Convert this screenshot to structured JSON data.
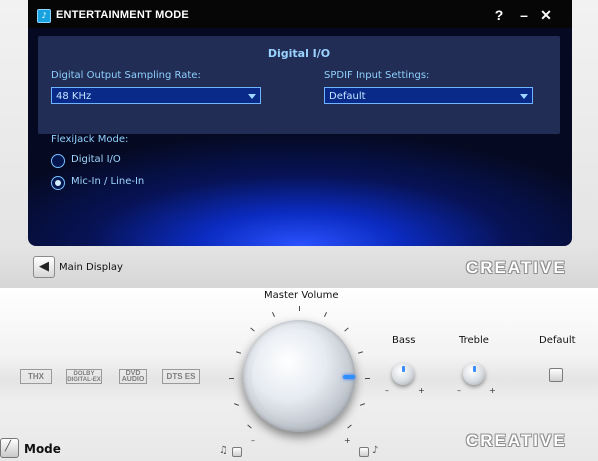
{
  "window": {
    "title": "ENTERTAINMENT MODE",
    "help_label": "?",
    "minimize_label": "–",
    "close_label": "✕",
    "icon": "speaker-app-icon"
  },
  "panel": {
    "title": "Digital I/O",
    "output_rate": {
      "label": "Digital Output Sampling Rate:",
      "value": "48 KHz"
    },
    "spdif": {
      "label": "SPDIF Input Settings:",
      "value": "Default"
    }
  },
  "flexijack": {
    "label": "FlexiJack Mode:",
    "options": [
      {
        "label": "Digital I/O",
        "selected": false
      },
      {
        "label": "Mic-In / Line-In",
        "selected": true
      }
    ]
  },
  "nav": {
    "back_label": "Main Display",
    "back_icon": "arrow-left-icon"
  },
  "brand": "CREATIVE",
  "controls": {
    "master_volume_label": "Master Volume",
    "bass_label": "Bass",
    "treble_label": "Treble",
    "default_label": "Default",
    "plus": "+",
    "minus": "–"
  },
  "logos": [
    "THX",
    "DOLBY DIGITAL-EX",
    "DVD AUDIO",
    "DTS ES"
  ],
  "footer": {
    "mode_label": "Mode"
  },
  "colors": {
    "accent": "#2f8fff",
    "screen_bg": "#071357",
    "panel_text": "#8fd0ff"
  }
}
